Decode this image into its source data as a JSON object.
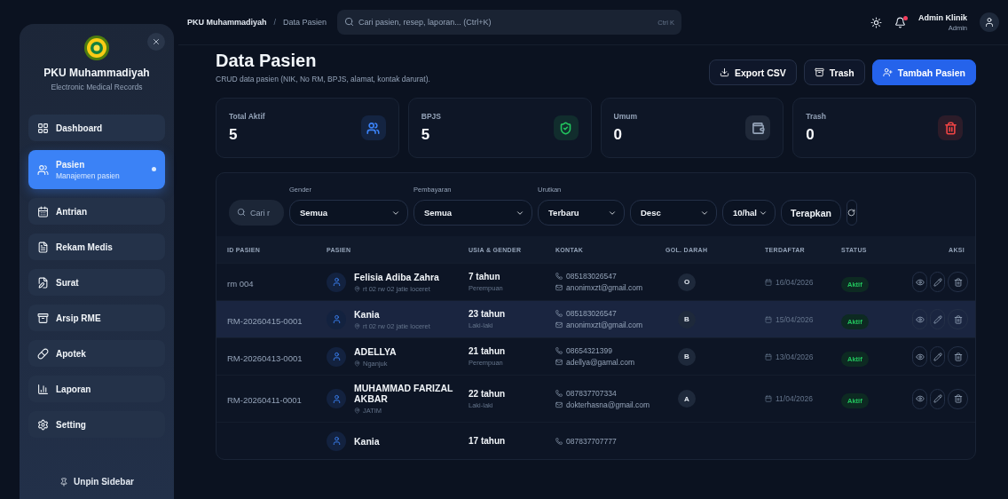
{
  "sidebar": {
    "brand": "PKU Muhammadiyah",
    "tagline": "Electronic Medical Records",
    "items": [
      {
        "label": "Dashboard",
        "selected": false
      },
      {
        "label": "Pasien",
        "subtitle": "Manajemen pasien",
        "selected": true
      },
      {
        "label": "Antrian",
        "selected": false
      },
      {
        "label": "Rekam Medis",
        "selected": false
      },
      {
        "label": "Surat",
        "selected": false
      },
      {
        "label": "Arsip RME",
        "selected": false
      },
      {
        "label": "Apotek",
        "selected": false
      },
      {
        "label": "Laporan",
        "selected": false
      },
      {
        "label": "Setting",
        "selected": false
      }
    ],
    "unpin": "Unpin Sidebar"
  },
  "topbar": {
    "breadcrumb": [
      "PKU Muhammadiyah",
      "Data Pasien"
    ],
    "breadcrumb_separator": "/",
    "search": {
      "placeholder": "Cari pasien, resep, laporan... (Ctrl+K)",
      "shortcut": "Ctrl K"
    },
    "notification": true,
    "user": {
      "name": "Admin Klinik",
      "role": "Admin"
    }
  },
  "header": {
    "title": "Data Pasien",
    "subtitle": "CRUD data pasien (NIK, No RM, BPJS, alamat, kontak darurat).",
    "buttons": [
      {
        "label": "Export CSV",
        "kind": "export"
      },
      {
        "label": "Trash",
        "kind": "trash"
      },
      {
        "label": "Tambah Pasien",
        "kind": "add"
      }
    ]
  },
  "stats": [
    {
      "label": "Total Aktif",
      "value": "5",
      "color": "#3b82f6"
    },
    {
      "label": "BPJS",
      "value": "5",
      "color": "#22c55e"
    },
    {
      "label": "Umum",
      "value": "0",
      "color": "#94a3b8"
    },
    {
      "label": "Trash",
      "value": "0",
      "color": "#ef4444"
    }
  ],
  "filters": {
    "search": {
      "placeholder": "Cari r"
    },
    "selects": [
      {
        "label": "Gender",
        "value": "Semua"
      },
      {
        "label": "Pembayaran",
        "value": "Semua"
      },
      {
        "label": "Urutkan",
        "value": "Terbaru"
      },
      {
        "value": "Desc"
      },
      {
        "value": "10/hal"
      }
    ],
    "apply": "Terapkan"
  },
  "table": {
    "columns": [
      "ID PASIEN",
      "PASIEN",
      "USIA & GENDER",
      "KONTAK",
      "GOL. DARAH",
      "TERDAFTAR",
      "STATUS",
      "AKSI"
    ],
    "rows": [
      {
        "id": "rm 004",
        "name": "Felisia Adiba Zahra",
        "address": "rt 02 rw 02 jatie loceret",
        "age": "7 tahun",
        "gender": "Perempuan",
        "phone": "085183026547",
        "email": "anonimxzt@gmail.com",
        "blood": "O",
        "registered": "16/04/2026",
        "status": "Aktif",
        "selected": false
      },
      {
        "id": "RM-20260415-0001",
        "name": "Kania",
        "address": "rt 02 rw 02 jatie loceret",
        "age": "23 tahun",
        "gender": "Laki-laki",
        "phone": "085183026547",
        "email": "anonimxzt@gmail.com",
        "blood": "B",
        "registered": "15/04/2026",
        "status": "Aktif",
        "selected": true
      },
      {
        "id": "RM-20260413-0001",
        "name": "ADELLYA",
        "address": "Nganjuk",
        "age": "21 tahun",
        "gender": "Perempuan",
        "phone": "08654321399",
        "email": "adellya@gamal.com",
        "blood": "B",
        "registered": "13/04/2026",
        "status": "Aktif",
        "selected": false
      },
      {
        "id": "RM-20260411-0001",
        "name": "MUHAMMAD FARIZAL AKBAR",
        "address": "JATIM",
        "age": "22 tahun",
        "gender": "Laki-laki",
        "phone": "087837707334",
        "email": "dokterhasna@gmail.com",
        "blood": "A",
        "registered": "11/04/2026",
        "status": "Aktif",
        "selected": false
      },
      {
        "name": "Kania",
        "age": "17 tahun",
        "phone": "087837707777",
        "selected": false
      }
    ]
  }
}
